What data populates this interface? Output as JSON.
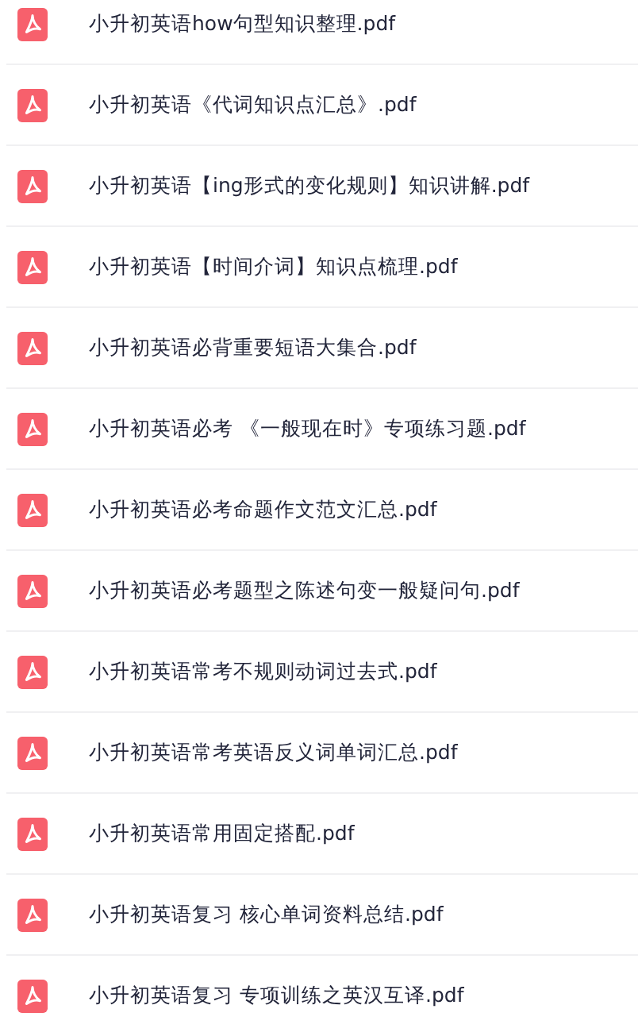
{
  "files": [
    {
      "name": "小升初英语how句型知识整理.pdf"
    },
    {
      "name": "小升初英语《代词知识点汇总》.pdf"
    },
    {
      "name": "小升初英语【ing形式的变化规则】知识讲解.pdf"
    },
    {
      "name": "小升初英语【时间介词】知识点梳理.pdf"
    },
    {
      "name": "小升初英语必背重要短语大集合.pdf"
    },
    {
      "name": "小升初英语必考 《一般现在时》专项练习题.pdf"
    },
    {
      "name": "小升初英语必考命题作文范文汇总.pdf"
    },
    {
      "name": "小升初英语必考题型之陈述句变一般疑问句.pdf"
    },
    {
      "name": "小升初英语常考不规则动词过去式.pdf"
    },
    {
      "name": "小升初英语常考英语反义词单词汇总.pdf"
    },
    {
      "name": "小升初英语常用固定搭配.pdf"
    },
    {
      "name": "小升初英语复习 核心单词资料总结.pdf"
    },
    {
      "name": "小升初英语复习 专项训练之英汉互译.pdf"
    }
  ]
}
